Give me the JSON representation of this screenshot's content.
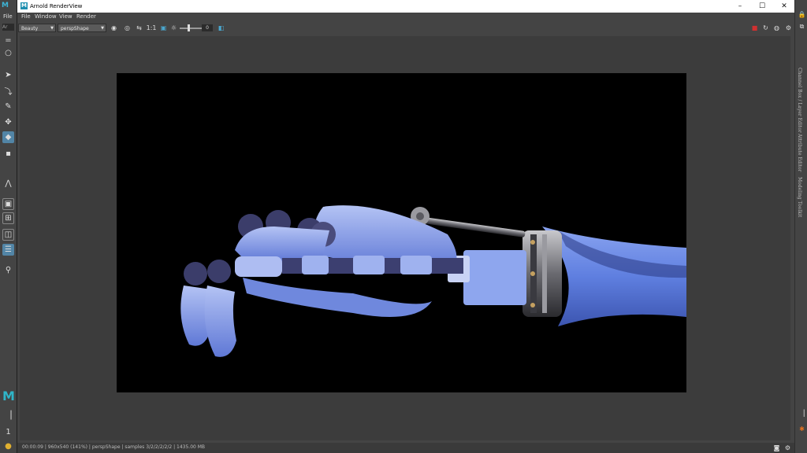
{
  "maya": {
    "file_menu": "File",
    "field_text": "Ar",
    "logo": "M"
  },
  "window": {
    "title": "Arnold RenderView",
    "minimize": "–",
    "maximize": "☐",
    "close": "✕"
  },
  "menu": [
    "File",
    "Window",
    "View",
    "Render"
  ],
  "toolbar": {
    "aov": "Beauty",
    "camera": "perspShape",
    "zoom_label": "1:1",
    "exposure_value": "0"
  },
  "right_tabs": [
    "Channel Box / Layer Editor",
    "Attribute Editor",
    "Modeling Toolkit"
  ],
  "status": {
    "text": "00:00:09 | 960x540 (141%) | perspShape | samples 3/2/2/2/2/2 | 1435.00 MB"
  },
  "colors": {
    "render_bg": "#000000",
    "hand_main": "#6e8ee8",
    "hand_light": "#aebdf2",
    "joint": "#3b3d6a",
    "metal": "#8a8a90",
    "accent": "#5285a6",
    "record": "#d03030"
  }
}
